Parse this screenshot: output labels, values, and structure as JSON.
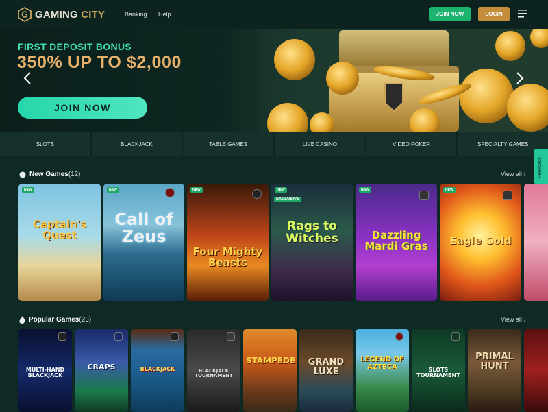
{
  "header": {
    "logo_primary": "GAMING",
    "logo_secondary": "CITY",
    "nav": [
      "Banking",
      "Help"
    ],
    "join_label": "JOIN NOW",
    "login_label": "LOGIN"
  },
  "hero": {
    "bonus_label": "FIRST DEPOSIT BONUS",
    "amount": "350% UP TO $2,000",
    "cta": "JOIN NOW"
  },
  "categories": [
    "SLOTS",
    "BLACKJACK",
    "TABLE GAMES",
    "LIVE CASINO",
    "VIDEO POKER",
    "SPECIALTY GAMES"
  ],
  "feedback": "Feedback",
  "new_games": {
    "title": "New Games",
    "count": "(12)",
    "view_all": "View all",
    "badge_new": "NEW",
    "badge_exclusive": "EXCLUSIVE",
    "games": [
      "Captain's Quest",
      "Call of Zeus",
      "Four Mighty Beasts",
      "Rags to Witches",
      "Dazzling Mardi Gras",
      "Eagle Gold",
      ""
    ]
  },
  "popular_games": {
    "title": "Popular Games",
    "count": "(23)",
    "view_all": "View all",
    "games": [
      "MULTI-HAND BLACKJACK",
      "CRAPS",
      "BLACKJACK",
      "BLACKJACK TOURNAMENT",
      "STAMPEDE",
      "GRAND LUXE",
      "LEGEND OF AZTECA",
      "SLOTS TOURNAMENT",
      "PRIMAL HUNT",
      ""
    ]
  },
  "colors": {
    "background": "#0f2a25",
    "header": "#0c231f",
    "join_green": "#1db36e",
    "login_gold": "#c58c3c",
    "bonus_text": "#3ee0b0",
    "amount_text": "#e7b16c"
  }
}
